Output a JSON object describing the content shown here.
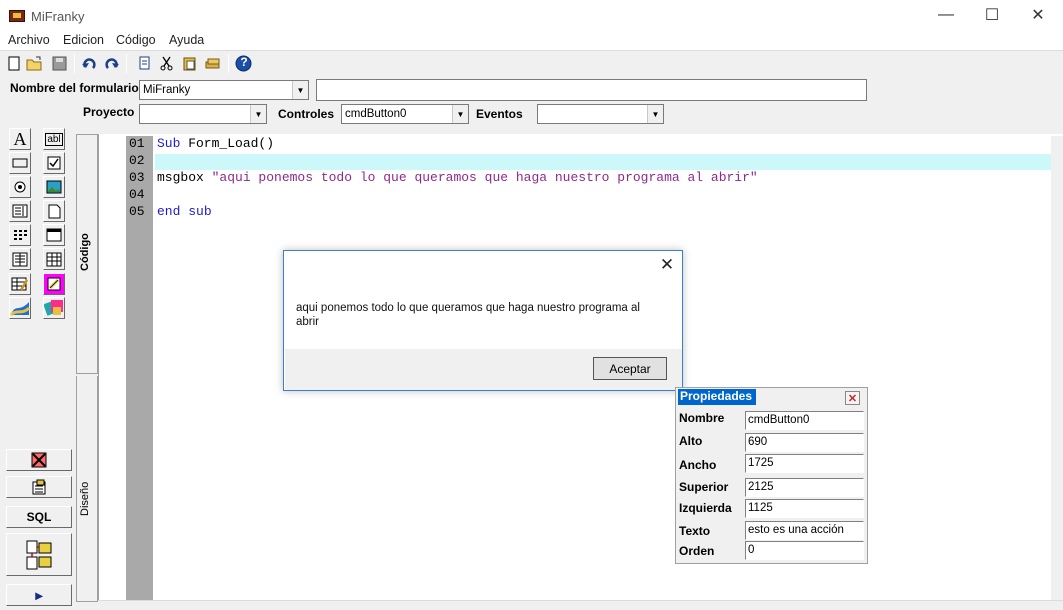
{
  "window": {
    "title": "MiFranky",
    "minimize": "—",
    "maximize": "☐",
    "close": "✕"
  },
  "menu": [
    "Archivo",
    "Edicion",
    "Código",
    "Ayuda"
  ],
  "toolbar": {
    "icons": [
      "new-file-icon",
      "open-folder-icon",
      "save-icon",
      "undo-icon",
      "redo-icon",
      "copy-icon",
      "cut-icon",
      "paste-icon",
      "stack-icon",
      "help-icon"
    ],
    "help_glyph": "?"
  },
  "form_header": {
    "name_label": "Nombre del formulario",
    "name_value": "MiFranky",
    "caption_value": "",
    "project_label": "Proyecto",
    "project_value": "",
    "controls_label": "Controles",
    "controls_value": "cmdButton0",
    "events_label": "Eventos",
    "events_value": ""
  },
  "toolbox": {
    "tools": [
      "label-tool-icon",
      "textbox-tool-icon",
      "button-tool-icon",
      "checkbox-tool-icon",
      "radio-tool-icon",
      "image-tool-icon",
      "listbox-tool-icon",
      "frame-tool-icon",
      "grid-tool-icon",
      "window-tool-icon",
      "report-tool-icon",
      "table-tool-icon",
      "edit-grid-tool-icon",
      "pencil-tool-icon",
      "chart-tool-icon",
      "shapes-tool-icon"
    ],
    "label_glyph": "A",
    "textbox_glyph": "abl",
    "delete_icon": "delete-icon",
    "properties_icon": "properties-icon",
    "sql_label": "SQL",
    "structure_icon": "structure-icon",
    "run_glyph": "▸"
  },
  "tabs": {
    "code": "Código",
    "design": "Diseño"
  },
  "editor": {
    "line_numbers": [
      "01",
      "02",
      "03",
      "04",
      "05"
    ],
    "line1_kw": "Sub",
    "line1_rest": " Form_Load()",
    "line3_cmd": "msgbox ",
    "line3_str": "\"aqui ponemos todo lo que queramos que haga nuestro programa al abrir\"",
    "line5_kw1": "end",
    "line5_kw2": "sub"
  },
  "msgbox": {
    "text": "aqui ponemos todo lo que queramos que haga nuestro programa al abrir",
    "ok_label": "Aceptar",
    "close_glyph": "✕"
  },
  "properties": {
    "title": "Propiedades",
    "close_glyph": "✕",
    "rows": [
      {
        "label": "Nombre",
        "value": "cmdButton0"
      },
      {
        "label": "Alto",
        "value": "690"
      },
      {
        "label": "Ancho",
        "value": "1725"
      },
      {
        "label": "Superior",
        "value": "2125"
      },
      {
        "label": "Izquierda",
        "value": "1125"
      },
      {
        "label": "Texto",
        "value": "esto es una acción"
      },
      {
        "label": "Orden",
        "value": "0"
      }
    ]
  }
}
